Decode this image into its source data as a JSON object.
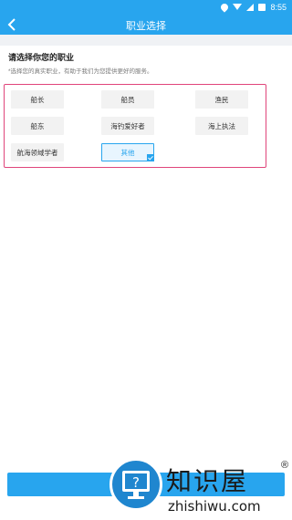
{
  "status_bar": {
    "time": "8:55"
  },
  "header": {
    "title": "职业选择"
  },
  "page": {
    "heading": "请选择你您的职业",
    "hint": "*选择您的真实职业，有助于我们为您提供更好的服务。"
  },
  "options": [
    {
      "label": "船长",
      "selected": false
    },
    {
      "label": "船员",
      "selected": false
    },
    {
      "label": "渔民",
      "selected": false
    },
    {
      "label": "船东",
      "selected": false
    },
    {
      "label": "海钓爱好者",
      "selected": false
    },
    {
      "label": "海上执法",
      "selected": false
    },
    {
      "label": "航海领域学者",
      "selected": false
    },
    {
      "label": "其他",
      "selected": true
    }
  ],
  "watermark": {
    "name": "知识屋",
    "domain": "zhishiwu.com",
    "reg": "®"
  },
  "colors": {
    "primary": "#28a5ee",
    "highlight_border": "#e0457b"
  },
  "icons": [
    "location-icon",
    "wifi-icon",
    "signal-icon",
    "battery-icon",
    "back-arrow-icon",
    "check-icon",
    "question-monitor-icon"
  ]
}
